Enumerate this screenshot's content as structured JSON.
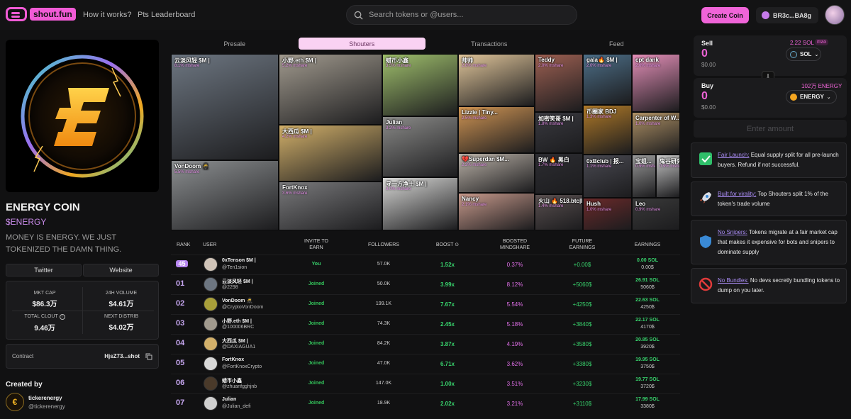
{
  "header": {
    "logo_text": "shout.fun",
    "nav": [
      "How it works?",
      "Pts Leaderboard"
    ],
    "search_placeholder": "Search tokens or @users...",
    "create_label": "Create Coin",
    "wallet_label": "BR3c...BA8g"
  },
  "coin": {
    "name": "ENERGY COIN",
    "ticker": "$ENERGY",
    "description": "MONEY IS ENERGY. WE JUST TOKENIZED THE DAMN THING.",
    "twitter_label": "Twitter",
    "website_label": "Website",
    "stats": {
      "mkt_cap_label": "MKT CAP",
      "mkt_cap": "$86.3万",
      "volume_label": "24H VOLUME",
      "volume": "$4.61万",
      "clout_label": "TOTAL CLOUT",
      "clout": "9.46万",
      "distrib_label": "NEXT DISTRIB",
      "distrib": "$4.02万"
    },
    "contract_label": "Contract",
    "contract_value": "HjsZ73...shot",
    "created_by_label": "Created by",
    "creator_name": "tickerenergy",
    "creator_handle": "@tickerenergy"
  },
  "tabs": [
    {
      "label": "Presale",
      "active": false
    },
    {
      "label": "Shouters",
      "active": true
    },
    {
      "label": "Transactions",
      "active": false
    },
    {
      "label": "Feed",
      "active": false
    }
  ],
  "mosaic": [
    {
      "name": "云淡风轻 $M |",
      "share": "8.1% mshare",
      "color": "#6d7681"
    },
    {
      "name": "VonDoom 🥷",
      "share": "5.5% mshare",
      "color": "#8c8f91"
    },
    {
      "name": "小野.eth $M |",
      "share": "5.2% mshare",
      "color": "#a19a8e"
    },
    {
      "name": "大西瓜 $M |",
      "share": "4.2% mshare",
      "color": "#d2b06a"
    },
    {
      "name": "FortKnox",
      "share": "3.6% mshare",
      "color": "#7a7a7c"
    },
    {
      "name": "蜡币小鑫",
      "share": "3.5% mshare",
      "color": "#9fbf6c"
    },
    {
      "name": "Julian",
      "share": "3.2% mshare",
      "color": "#8a8a88"
    },
    {
      "name": "寻一方净土 $M |",
      "share": "3.0% mshare",
      "color": "#d8d8d6"
    },
    {
      "name": "帅帅",
      "share": "2.8% mshare",
      "color": "#e0c59a"
    },
    {
      "name": "Lizzie | Tiny...",
      "share": "2.5% mshare",
      "color": "#d09554"
    },
    {
      "name": "💔Superdan $M...",
      "share": "2.2% mshare",
      "color": "#bbb2a8"
    },
    {
      "name": "Nancy",
      "share": "2.1% mshare",
      "color": "#c89a8c"
    },
    {
      "name": "Teddy",
      "share": "2.0% mshare",
      "color": "#9d6052"
    },
    {
      "name": "加密笑哥 $M |",
      "share": "1.8% mshare",
      "color": "#3a3a40"
    },
    {
      "name": "BW 🔥 黑白",
      "share": "1.7% mshare",
      "color": "#2d2d32"
    },
    {
      "name": "火山 🔥 518.btc|Bir...",
      "share": "1.4% mshare",
      "color": "#5a5050"
    },
    {
      "name": "gala🔥 $M |",
      "share": "2.0% mshare",
      "color": "#4d6f88"
    },
    {
      "name": "币圈家 BDJ",
      "share": "1.3% mshare",
      "color": "#b07a28"
    },
    {
      "name": "0xBclub | 报...",
      "share": "1.1% mshare",
      "color": "#4a4a52"
    },
    {
      "name": "Hush",
      "share": "1.0% mshare",
      "color": "#6b2a2a"
    },
    {
      "name": "cpt dank",
      "share": "2.0% mshare",
      "color": "#e48fb8"
    },
    {
      "name": "Carpenter of W...",
      "share": "1.0% mshare",
      "color": "#b09266"
    },
    {
      "name": "宝姐...",
      "share": "0.9% mshare",
      "color": "#9a9a9a"
    },
    {
      "name": "鬼谷研究...",
      "share": "0.9% mshare",
      "color": "#c8c8c8"
    },
    {
      "name": "Leo",
      "share": "0.9% mshare",
      "color": "#3a3a3a"
    }
  ],
  "table": {
    "headers": [
      "RANK",
      "USER",
      "INVITE TO EARN",
      "FOLLOWERS",
      "BOOST",
      "BOOSTED MINDSHARE",
      "FUTURE EARNINGS",
      "EARNINGS"
    ],
    "rows": [
      {
        "rank": "45",
        "name": "0xTenson $M |",
        "handle": "@Ten1sion",
        "invite": "You",
        "followers": "57.0K",
        "boost": "1.52x",
        "mindshare": "0.37%",
        "future": "+0.00$",
        "earn_sol": "0.00 SOL",
        "earn_usd": "0.00$",
        "avatar": "#d0c4b8"
      },
      {
        "rank": "01",
        "name": "云淡风轻 $M |",
        "handle": "@2298",
        "invite": "Joined",
        "followers": "50.0K",
        "boost": "3.99x",
        "mindshare": "8.12%",
        "future": "+5060$",
        "earn_sol": "26.91 SOL",
        "earn_usd": "5060$",
        "avatar": "#6d7681"
      },
      {
        "rank": "02",
        "name": "VonDoom 🥷",
        "handle": "@CryptoVonDoom",
        "invite": "Joined",
        "followers": "199.1K",
        "boost": "7.67x",
        "mindshare": "5.54%",
        "future": "+4250$",
        "earn_sol": "22.63 SOL",
        "earn_usd": "4250$",
        "avatar": "#a89f3a"
      },
      {
        "rank": "03",
        "name": "小野.eth $M |",
        "handle": "@100006BRC",
        "invite": "Joined",
        "followers": "74.3K",
        "boost": "2.45x",
        "mindshare": "5.18%",
        "future": "+3840$",
        "earn_sol": "22.17 SOL",
        "earn_usd": "4170$",
        "avatar": "#a19a8e"
      },
      {
        "rank": "04",
        "name": "大西瓜 $M |",
        "handle": "@DAXIAGUA1",
        "invite": "Joined",
        "followers": "84.2K",
        "boost": "3.87x",
        "mindshare": "4.19%",
        "future": "+3580$",
        "earn_sol": "20.85 SOL",
        "earn_usd": "3920$",
        "avatar": "#d2b06a"
      },
      {
        "rank": "05",
        "name": "FortKnox",
        "handle": "@FortKnoxCrypto",
        "invite": "Joined",
        "followers": "47.0K",
        "boost": "6.71x",
        "mindshare": "3.62%",
        "future": "+3380$",
        "earn_sol": "19.95 SOL",
        "earn_usd": "3750$",
        "avatar": "#d8d8d8"
      },
      {
        "rank": "06",
        "name": "蜡币小鑫",
        "handle": "@zhuanfgghjnb",
        "invite": "Joined",
        "followers": "147.0K",
        "boost": "1.00x",
        "mindshare": "3.51%",
        "future": "+3230$",
        "earn_sol": "19.77 SOL",
        "earn_usd": "3720$",
        "avatar": "#4a3a2a"
      },
      {
        "rank": "07",
        "name": "Julian",
        "handle": "@Julian_defi",
        "invite": "Joined",
        "followers": "18.9K",
        "boost": "2.02x",
        "mindshare": "3.21%",
        "future": "+3110$",
        "earn_sol": "17.99 SOL",
        "earn_usd": "3380$",
        "avatar": "#cfcfcf"
      }
    ]
  },
  "swap": {
    "sell_label": "Sell",
    "sell_value": "0",
    "sell_usd": "$0.00",
    "sell_balance": "2.22 SOL",
    "max_label": "max",
    "sell_token": "SOL",
    "buy_label": "Buy",
    "buy_value": "0",
    "buy_usd": "$0.00",
    "buy_balance": "102万 ENERGY",
    "buy_token": "ENERGY",
    "enter_amount": "Enter amount"
  },
  "features": [
    {
      "title": "Fair Launch:",
      "text": " Equal supply split for all pre-launch buyers. Refund if not successful.",
      "icon": "check-icon"
    },
    {
      "title": "Built for virality:",
      "text": " Top Shouters split 1% of the token's trade volume",
      "icon": "rocket-icon"
    },
    {
      "title": "No Snipers:",
      "text": " Tokens migrate at a fair market cap that makes it expensive for bots and snipers to dominate supply",
      "icon": "shield-icon"
    },
    {
      "title": "No Bundles:",
      "text": " No devs secretly bundling tokens to dump on you later.",
      "icon": "ban-icon"
    }
  ],
  "colors": {
    "accent": "#f064d8",
    "green": "#38d26c",
    "purple": "#a88bf2"
  }
}
